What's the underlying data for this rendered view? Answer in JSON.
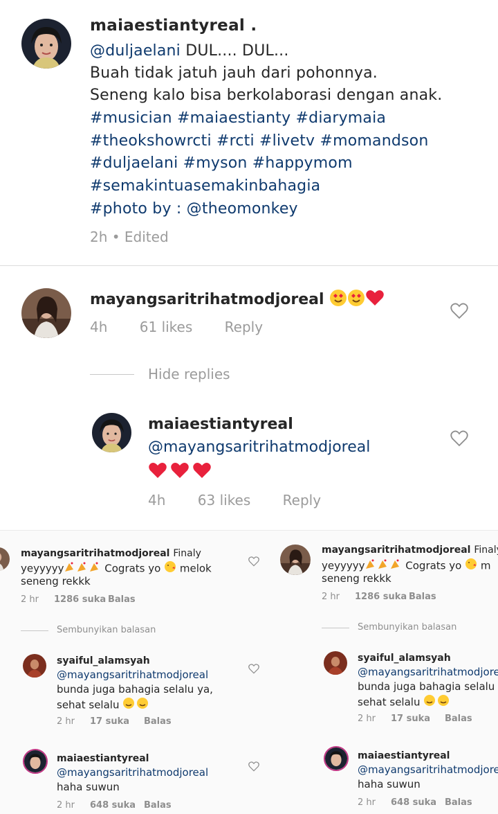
{
  "caption": {
    "username": "maiaestiantyreal .",
    "mention": "@duljaelani",
    "line1_rest": " DUL.... DUL...",
    "line2": "Buah tidak jatuh jauh dari pohonnya.",
    "line3": "Seneng kalo bisa berkolaborasi dengan anak.",
    "line4": "#musician #maiaestianty #diarymaia",
    "line5": "#theokshowrcti #rcti #livetv #momandson",
    "line6": "#duljaelani #myson #happymom",
    "line7": "#semakintuasemakinbahagia",
    "line8_prefix": "#photo by : ",
    "line8_mention": "@theomonkey",
    "meta": "2h • Edited"
  },
  "comment": {
    "username": "mayangsaritrihatmodjoreal",
    "time": "4h",
    "likes": "61 likes",
    "reply": "Reply"
  },
  "hide_replies": "Hide replies",
  "reply": {
    "username": "maiaestiantyreal",
    "mention": "@mayangsaritrihatmodjoreal",
    "time": "4h",
    "likes": "63 likes",
    "reply": "Reply"
  },
  "bottom": {
    "comment": {
      "username": "mayangsaritrihatmodjoreal",
      "text_start": "Finaly",
      "text_line2a": "yeyyyyy",
      "text_line2b": " Cograts yo ",
      "text_line2c": " melok",
      "text_line3": "seneng rekkk",
      "time": "2 hr",
      "likes": "1286 suka",
      "reply": "Balas"
    },
    "hide_replies": "Sembunyikan balasan",
    "reply1": {
      "username": "syaiful_alamsyah",
      "mention": "@mayangsaritrihatmodjoreal",
      "text_line1": "bunda juga bahagia selalu ya,",
      "text_line2": "sehat selalu ",
      "time": "2 hr",
      "likes": "17 suka",
      "reply": "Balas"
    },
    "reply2": {
      "username": "maiaestiantyreal",
      "mention": "@mayangsaritrihatmodjoreal",
      "text_line1": "haha suwun",
      "time": "2 hr",
      "likes": "648 suka",
      "reply": "Balas"
    },
    "right_copy": {
      "text_start": "Finaly",
      "text_line2c": " m",
      "text_line2_reply1": "bunda juga bahagia selalu",
      "time": "2 hr",
      "likes_comment": "1286 suka",
      "likes_reply1": "17 suka",
      "likes_reply2": "648 suka",
      "reply": "Balas"
    }
  },
  "colors": {
    "text": "#262626",
    "mention": "#0f3a6e",
    "muted": "#9b9b9b",
    "heart": "#e8213c"
  },
  "icons": [
    "heart-outline-icon",
    "red-heart-emoji",
    "heart-eyes-emoji",
    "party-popper-emoji",
    "kiss-emoji",
    "smile-emoji"
  ]
}
